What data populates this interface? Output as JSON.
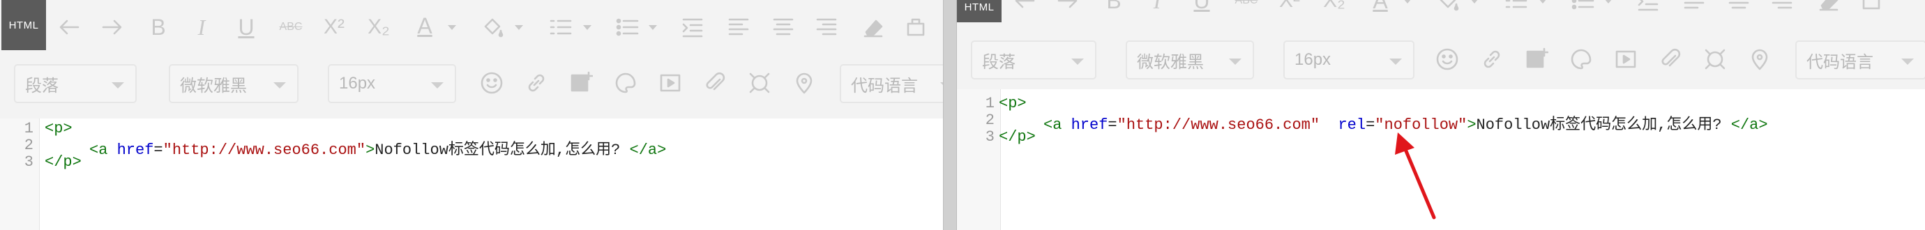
{
  "toolbar": {
    "html_label": "HTML",
    "icons": [
      "undo-icon",
      "redo-icon",
      "bold-icon",
      "italic-icon",
      "underline-icon",
      "strikethrough-icon",
      "superscript-icon",
      "subscript-icon",
      "font-color-icon",
      "background-color-icon",
      "ordered-list-icon",
      "unordered-list-icon",
      "indent-icon",
      "align-left-icon",
      "align-center-icon",
      "align-right-icon",
      "eraser-icon",
      "more-icon"
    ]
  },
  "selects": {
    "paragraph": "段落",
    "font_family": "微软雅黑",
    "font_size": "16px",
    "code_language": "代码语言"
  },
  "colors": {
    "tag": "#117711",
    "attribute": "#0000cc",
    "string": "#aa1111",
    "arrow": "#e0161b"
  },
  "left_editor": {
    "line_numbers": [
      "1",
      "2",
      "3"
    ],
    "line1": "<p>",
    "line2": {
      "open": "<a",
      "attr_href": "href",
      "eq": "=",
      "href_value": "\"http://www.seo66.com\"",
      "close_bracket": ">",
      "text": "Nofollow标签代码怎么加,怎么用?",
      "close_tag": "</a>"
    },
    "line3": "</p>"
  },
  "right_editor": {
    "line_numbers": [
      "1",
      "2",
      "3"
    ],
    "line1": "<p>",
    "line2": {
      "open": "<a",
      "attr_href": "href",
      "eq": "=",
      "href_value": "\"http://www.seo66.com\"",
      "attr_rel": "rel",
      "eq2": "=",
      "rel_value": "\"nofollow\"",
      "close_bracket": ">",
      "text": "Nofollow标签代码怎么加,怎么用?",
      "close_tag": "</a>"
    },
    "line3": "</p>"
  }
}
